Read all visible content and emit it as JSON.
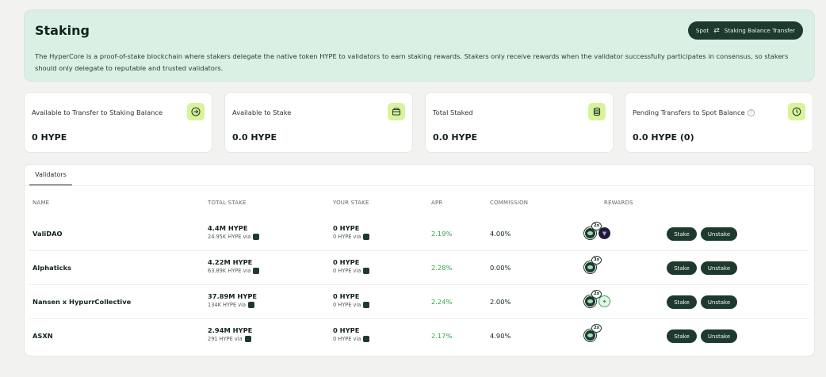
{
  "hero": {
    "title": "Staking",
    "description": "The HyperCore is a proof-of-stake blockchain where stakers delegate the native token HYPE to validators to earn staking rewards. Stakers only receive rewards when the validator successfully participates in consensus, so stakers should only delegate to reputable and trusted validators.",
    "button_left": "Spot",
    "button_right": "Staking Balance Transfer",
    "button_icon": "swap-arrows-icon"
  },
  "cards": [
    {
      "label": "Available to Transfer to Staking Balance",
      "value": "0 HYPE",
      "icon": "arrow-right-circle-icon"
    },
    {
      "label": "Available to Stake",
      "value": "0.0 HYPE",
      "icon": "wallet-icon"
    },
    {
      "label": "Total Staked",
      "value": "0.0 HYPE",
      "icon": "coin-stack-icon"
    },
    {
      "label": "Pending Transfers to Spot Balance",
      "value": "0.0 HYPE (0)",
      "icon": "clock-icon",
      "info": "?"
    }
  ],
  "validators": {
    "tab": "Validators",
    "headers": {
      "name": "NAME",
      "total_stake": "TOTAL STAKE",
      "your_stake": "YOUR STAKE",
      "apr": "APR",
      "commission": "COMMISSION",
      "rewards": "REWARDS"
    },
    "stake_label": "Stake",
    "unstake_label": "Unstake",
    "rows": [
      {
        "name": "ValiDAO",
        "total": "4.4M HYPE",
        "total_sub": "24.95K HYPE via",
        "yours": "0 HYPE",
        "yours_sub": "0 HYPE via",
        "apr": "2.19%",
        "commission": "4.00%",
        "multiplier": "2x",
        "extra_token": "purple-token-icon"
      },
      {
        "name": "Alphaticks",
        "total": "4.22M HYPE",
        "total_sub": "63.89K HYPE via",
        "yours": "0 HYPE",
        "yours_sub": "0 HYPE via",
        "apr": "2.28%",
        "commission": "0.00%",
        "multiplier": "3x",
        "extra_token": ""
      },
      {
        "name": "Nansen x HypurrCollective",
        "total": "37.89M HYPE",
        "total_sub": "134K HYPE via",
        "yours": "0 HYPE",
        "yours_sub": "0 HYPE via",
        "apr": "2.24%",
        "commission": "2.00%",
        "multiplier": "2x",
        "extra_token": "green-token-icon"
      },
      {
        "name": "ASXN",
        "total": "2.94M HYPE",
        "total_sub": "291 HYPE via",
        "yours": "0 HYPE",
        "yours_sub": "0 HYPE via",
        "apr": "2.17%",
        "commission": "4.90%",
        "multiplier": "2x",
        "extra_token": ""
      }
    ]
  },
  "colors": {
    "accent": "#1e3a2e",
    "hero_bg": "#dbf0e4",
    "icon_bg": "#d9f39b",
    "apr_green": "#35a24a"
  }
}
